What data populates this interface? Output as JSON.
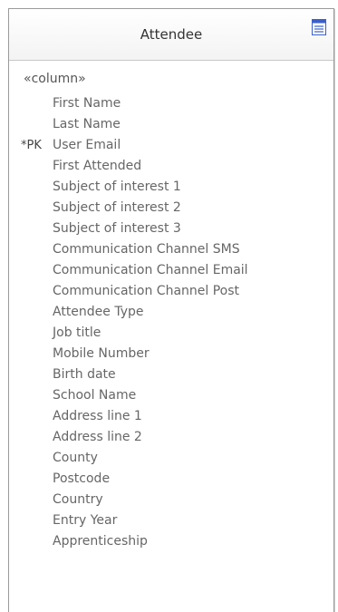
{
  "entity": {
    "title": "Attendee",
    "icon": "table-icon",
    "stereotype": "«column»",
    "attributes": [
      {
        "key": "",
        "name": "First Name"
      },
      {
        "key": "",
        "name": "Last Name"
      },
      {
        "key": "*PK",
        "name": "User Email"
      },
      {
        "key": "",
        "name": "First Attended"
      },
      {
        "key": "",
        "name": "Subject of interest 1"
      },
      {
        "key": "",
        "name": "Subject of interest 2"
      },
      {
        "key": "",
        "name": "Subject of interest 3"
      },
      {
        "key": "",
        "name": "Communication Channel SMS"
      },
      {
        "key": "",
        "name": "Communication Channel Email"
      },
      {
        "key": "",
        "name": "Communication Channel Post"
      },
      {
        "key": "",
        "name": "Attendee Type"
      },
      {
        "key": "",
        "name": "Job title"
      },
      {
        "key": "",
        "name": "Mobile Number"
      },
      {
        "key": "",
        "name": "Birth date"
      },
      {
        "key": "",
        "name": "School Name"
      },
      {
        "key": "",
        "name": "Address line 1"
      },
      {
        "key": "",
        "name": "Address line 2"
      },
      {
        "key": "",
        "name": "County"
      },
      {
        "key": "",
        "name": "Postcode"
      },
      {
        "key": "",
        "name": "Country"
      },
      {
        "key": "",
        "name": "Entry Year"
      },
      {
        "key": "",
        "name": "Apprenticeship"
      }
    ]
  },
  "colors": {
    "border": "#9a9a9a",
    "icon_blue": "#3a5fcd",
    "text": "#666666"
  }
}
